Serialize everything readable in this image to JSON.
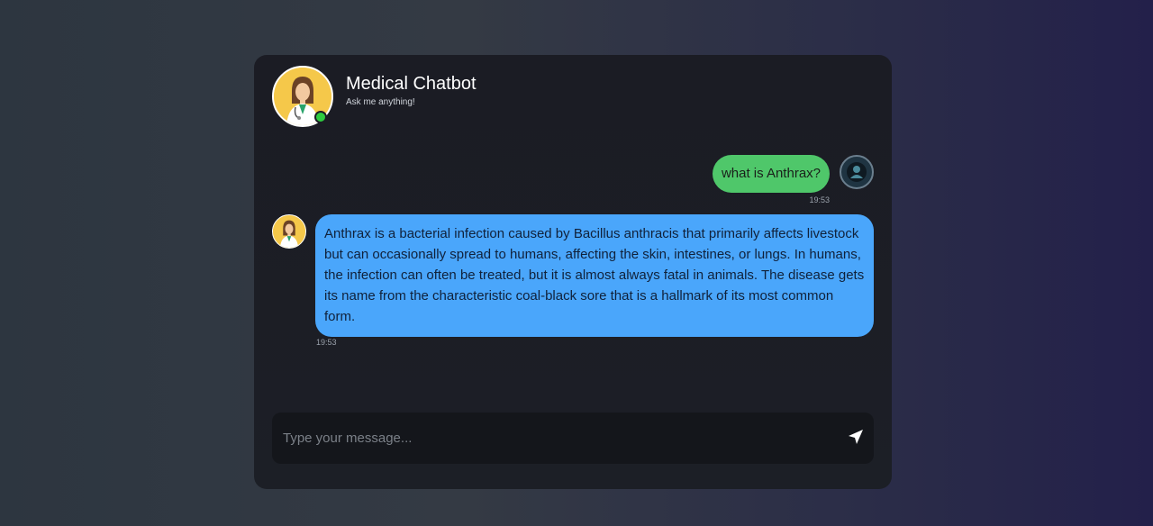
{
  "header": {
    "title": "Medical Chatbot",
    "subtitle": "Ask me anything!",
    "avatar_icon": "doctor-avatar-icon",
    "status_color": "#2ecc40"
  },
  "messages": [
    {
      "sender": "user",
      "text": "what is Anthrax?",
      "time": "19:53",
      "bubble_color": "#4fc76a",
      "avatar_icon": "user-avatar-icon"
    },
    {
      "sender": "bot",
      "text": "Anthrax is a bacterial infection caused by Bacillus anthracis that primarily affects livestock but can occasionally spread to humans, affecting the skin, intestines, or lungs. In humans, the infection can often be treated, but it is almost always fatal in animals. The disease gets its name from the characteristic coal-black sore that is a hallmark of its most common form.",
      "time": "19:53",
      "bubble_color": "#4aa6fb",
      "avatar_icon": "doctor-avatar-icon"
    }
  ],
  "input": {
    "placeholder": "Type your message...",
    "value": "",
    "send_icon": "send-icon"
  }
}
